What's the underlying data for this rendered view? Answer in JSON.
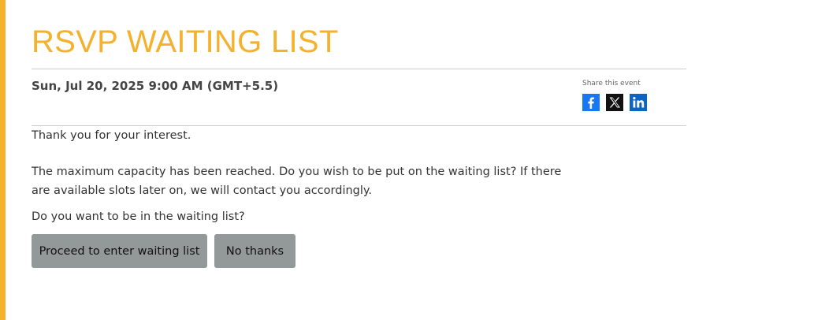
{
  "page": {
    "title": "RSVP WAITING LIST",
    "event_datetime": "Sun, Jul 20, 2025 9:00 AM (GMT+5.5)"
  },
  "share": {
    "label": "Share this event",
    "icons": [
      "facebook-icon",
      "x-twitter-icon",
      "linkedin-icon"
    ]
  },
  "message": {
    "thanks": "Thank you for your interest.",
    "capacity": "The maximum capacity has been reached. Do you wish to be put on the waiting list? If there are available slots later on, we will contact you accordingly.",
    "question": "Do you want to be in the waiting list?"
  },
  "actions": {
    "proceed_label": "Proceed to enter waiting list",
    "decline_label": "No thanks"
  },
  "colors": {
    "accent": "#f3b12e",
    "button_bg": "#939998",
    "facebook": "#1877f2",
    "x": "#111111",
    "linkedin": "#0a66c2"
  }
}
